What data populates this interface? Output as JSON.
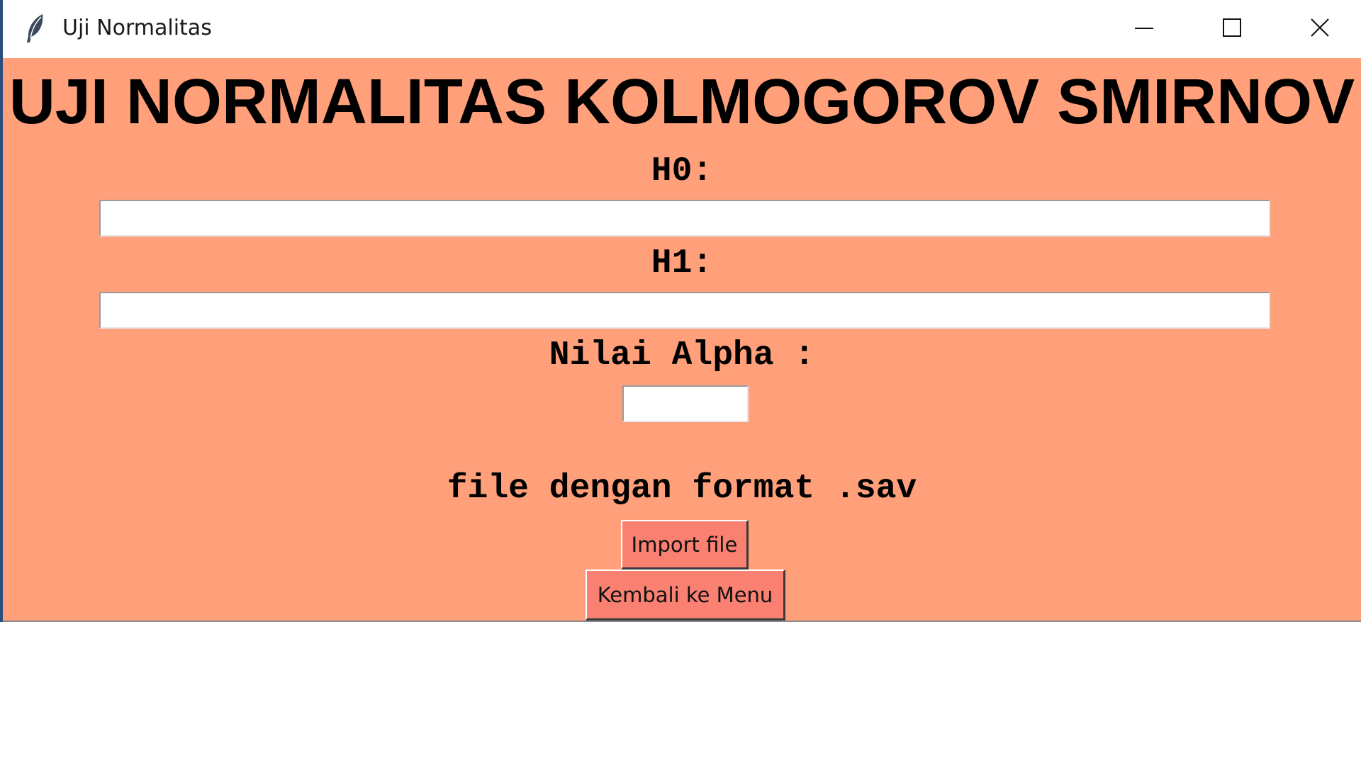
{
  "window": {
    "title": "Uji Normalitas",
    "app_icon": "feather-icon",
    "controls": {
      "minimize_icon": "minimize-icon",
      "maximize_icon": "maximize-icon",
      "close_icon": "close-icon"
    }
  },
  "form": {
    "heading": "UJI NORMALITAS KOLMOGOROV SMIRNOV",
    "h0_label": "H0:",
    "h0_value": "",
    "h1_label": "H1:",
    "h1_value": "",
    "alpha_label": "Nilai Alpha :",
    "alpha_value": "",
    "file_hint": "file dengan format .sav",
    "import_button": "Import file",
    "back_button": "Kembali ke Menu"
  },
  "colors": {
    "background": "#ffa07a",
    "button": "#fa8072",
    "entry": "#ffffff"
  }
}
